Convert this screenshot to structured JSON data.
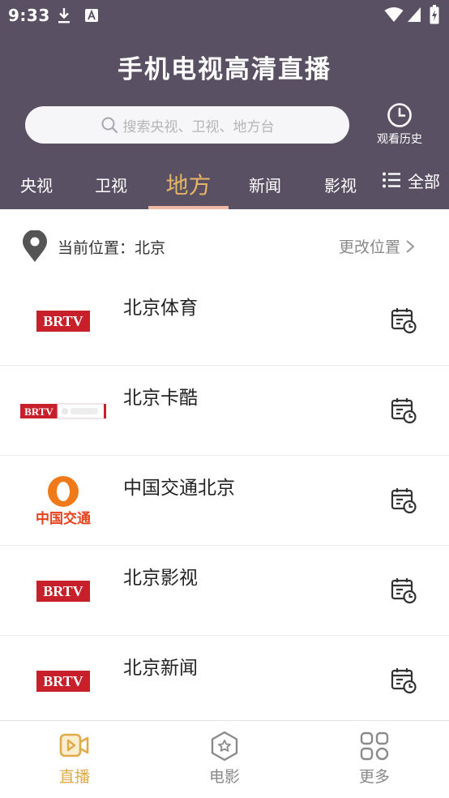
{
  "status_bar": {
    "time": "9:33",
    "icons": [
      "download-icon",
      "app-a-icon",
      "wifi-icon",
      "cell-signal-icon",
      "battery-charging-icon"
    ]
  },
  "header": {
    "title": "手机电视高清直播",
    "search": {
      "placeholder": "搜索央视、卫视、地方台"
    },
    "history": {
      "label": "观看历史",
      "icon": "clock-icon"
    }
  },
  "tabs": {
    "items": [
      {
        "label": "央视",
        "active": false
      },
      {
        "label": "卫视",
        "active": false
      },
      {
        "label": "地方",
        "active": true
      },
      {
        "label": "新闻",
        "active": false
      },
      {
        "label": "影视",
        "active": false
      }
    ],
    "all_label": "全部"
  },
  "location": {
    "current": "当前位置：北京",
    "change": "更改位置"
  },
  "channels": [
    {
      "name": "北京体育",
      "logo": "BRTV"
    },
    {
      "name": "北京卡酷",
      "logo": "BRTV 卡酷少儿"
    },
    {
      "name": "中国交通北京",
      "logo": "中国交通"
    },
    {
      "name": "北京影视",
      "logo": "BRTV"
    },
    {
      "name": "北京新闻",
      "logo": "BRTV"
    }
  ],
  "bottom_nav": [
    {
      "label": "直播",
      "icon": "live-video-icon",
      "active": true
    },
    {
      "label": "电影",
      "icon": "movie-hexagon-icon",
      "active": false
    },
    {
      "label": "更多",
      "icon": "more-grid-icon",
      "active": false
    }
  ],
  "colors": {
    "header_bg": "#5a5064",
    "accent_gold": "#e6b464",
    "tab_underline": "#f0b9a4",
    "brtv_red": "#c8202a",
    "nav_active": "#e0a94a"
  }
}
